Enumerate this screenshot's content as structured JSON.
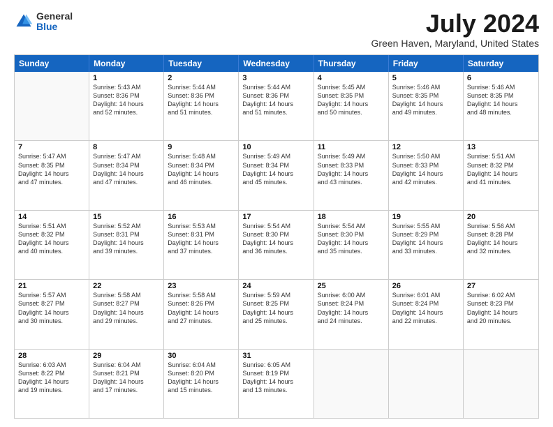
{
  "logo": {
    "general": "General",
    "blue": "Blue"
  },
  "title": "July 2024",
  "location": "Green Haven, Maryland, United States",
  "header_days": [
    "Sunday",
    "Monday",
    "Tuesday",
    "Wednesday",
    "Thursday",
    "Friday",
    "Saturday"
  ],
  "weeks": [
    [
      {
        "day": "",
        "lines": []
      },
      {
        "day": "1",
        "lines": [
          "Sunrise: 5:43 AM",
          "Sunset: 8:36 PM",
          "Daylight: 14 hours",
          "and 52 minutes."
        ]
      },
      {
        "day": "2",
        "lines": [
          "Sunrise: 5:44 AM",
          "Sunset: 8:36 PM",
          "Daylight: 14 hours",
          "and 51 minutes."
        ]
      },
      {
        "day": "3",
        "lines": [
          "Sunrise: 5:44 AM",
          "Sunset: 8:36 PM",
          "Daylight: 14 hours",
          "and 51 minutes."
        ]
      },
      {
        "day": "4",
        "lines": [
          "Sunrise: 5:45 AM",
          "Sunset: 8:35 PM",
          "Daylight: 14 hours",
          "and 50 minutes."
        ]
      },
      {
        "day": "5",
        "lines": [
          "Sunrise: 5:46 AM",
          "Sunset: 8:35 PM",
          "Daylight: 14 hours",
          "and 49 minutes."
        ]
      },
      {
        "day": "6",
        "lines": [
          "Sunrise: 5:46 AM",
          "Sunset: 8:35 PM",
          "Daylight: 14 hours",
          "and 48 minutes."
        ]
      }
    ],
    [
      {
        "day": "7",
        "lines": [
          "Sunrise: 5:47 AM",
          "Sunset: 8:35 PM",
          "Daylight: 14 hours",
          "and 47 minutes."
        ]
      },
      {
        "day": "8",
        "lines": [
          "Sunrise: 5:47 AM",
          "Sunset: 8:34 PM",
          "Daylight: 14 hours",
          "and 47 minutes."
        ]
      },
      {
        "day": "9",
        "lines": [
          "Sunrise: 5:48 AM",
          "Sunset: 8:34 PM",
          "Daylight: 14 hours",
          "and 46 minutes."
        ]
      },
      {
        "day": "10",
        "lines": [
          "Sunrise: 5:49 AM",
          "Sunset: 8:34 PM",
          "Daylight: 14 hours",
          "and 45 minutes."
        ]
      },
      {
        "day": "11",
        "lines": [
          "Sunrise: 5:49 AM",
          "Sunset: 8:33 PM",
          "Daylight: 14 hours",
          "and 43 minutes."
        ]
      },
      {
        "day": "12",
        "lines": [
          "Sunrise: 5:50 AM",
          "Sunset: 8:33 PM",
          "Daylight: 14 hours",
          "and 42 minutes."
        ]
      },
      {
        "day": "13",
        "lines": [
          "Sunrise: 5:51 AM",
          "Sunset: 8:32 PM",
          "Daylight: 14 hours",
          "and 41 minutes."
        ]
      }
    ],
    [
      {
        "day": "14",
        "lines": [
          "Sunrise: 5:51 AM",
          "Sunset: 8:32 PM",
          "Daylight: 14 hours",
          "and 40 minutes."
        ]
      },
      {
        "day": "15",
        "lines": [
          "Sunrise: 5:52 AM",
          "Sunset: 8:31 PM",
          "Daylight: 14 hours",
          "and 39 minutes."
        ]
      },
      {
        "day": "16",
        "lines": [
          "Sunrise: 5:53 AM",
          "Sunset: 8:31 PM",
          "Daylight: 14 hours",
          "and 37 minutes."
        ]
      },
      {
        "day": "17",
        "lines": [
          "Sunrise: 5:54 AM",
          "Sunset: 8:30 PM",
          "Daylight: 14 hours",
          "and 36 minutes."
        ]
      },
      {
        "day": "18",
        "lines": [
          "Sunrise: 5:54 AM",
          "Sunset: 8:30 PM",
          "Daylight: 14 hours",
          "and 35 minutes."
        ]
      },
      {
        "day": "19",
        "lines": [
          "Sunrise: 5:55 AM",
          "Sunset: 8:29 PM",
          "Daylight: 14 hours",
          "and 33 minutes."
        ]
      },
      {
        "day": "20",
        "lines": [
          "Sunrise: 5:56 AM",
          "Sunset: 8:28 PM",
          "Daylight: 14 hours",
          "and 32 minutes."
        ]
      }
    ],
    [
      {
        "day": "21",
        "lines": [
          "Sunrise: 5:57 AM",
          "Sunset: 8:27 PM",
          "Daylight: 14 hours",
          "and 30 minutes."
        ]
      },
      {
        "day": "22",
        "lines": [
          "Sunrise: 5:58 AM",
          "Sunset: 8:27 PM",
          "Daylight: 14 hours",
          "and 29 minutes."
        ]
      },
      {
        "day": "23",
        "lines": [
          "Sunrise: 5:58 AM",
          "Sunset: 8:26 PM",
          "Daylight: 14 hours",
          "and 27 minutes."
        ]
      },
      {
        "day": "24",
        "lines": [
          "Sunrise: 5:59 AM",
          "Sunset: 8:25 PM",
          "Daylight: 14 hours",
          "and 25 minutes."
        ]
      },
      {
        "day": "25",
        "lines": [
          "Sunrise: 6:00 AM",
          "Sunset: 8:24 PM",
          "Daylight: 14 hours",
          "and 24 minutes."
        ]
      },
      {
        "day": "26",
        "lines": [
          "Sunrise: 6:01 AM",
          "Sunset: 8:24 PM",
          "Daylight: 14 hours",
          "and 22 minutes."
        ]
      },
      {
        "day": "27",
        "lines": [
          "Sunrise: 6:02 AM",
          "Sunset: 8:23 PM",
          "Daylight: 14 hours",
          "and 20 minutes."
        ]
      }
    ],
    [
      {
        "day": "28",
        "lines": [
          "Sunrise: 6:03 AM",
          "Sunset: 8:22 PM",
          "Daylight: 14 hours",
          "and 19 minutes."
        ]
      },
      {
        "day": "29",
        "lines": [
          "Sunrise: 6:04 AM",
          "Sunset: 8:21 PM",
          "Daylight: 14 hours",
          "and 17 minutes."
        ]
      },
      {
        "day": "30",
        "lines": [
          "Sunrise: 6:04 AM",
          "Sunset: 8:20 PM",
          "Daylight: 14 hours",
          "and 15 minutes."
        ]
      },
      {
        "day": "31",
        "lines": [
          "Sunrise: 6:05 AM",
          "Sunset: 8:19 PM",
          "Daylight: 14 hours",
          "and 13 minutes."
        ]
      },
      {
        "day": "",
        "lines": []
      },
      {
        "day": "",
        "lines": []
      },
      {
        "day": "",
        "lines": []
      }
    ]
  ]
}
